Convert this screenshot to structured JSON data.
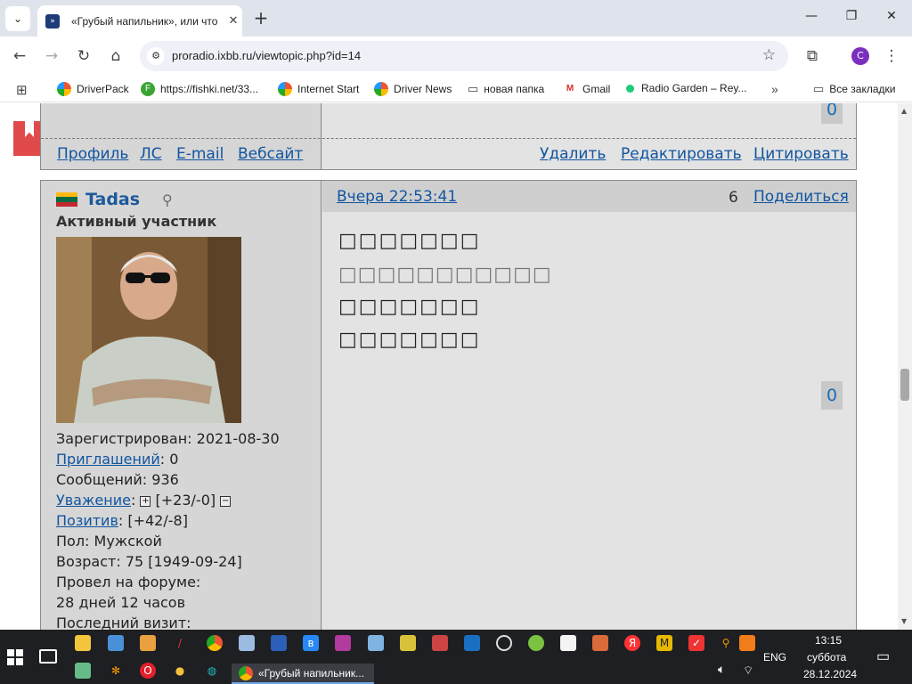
{
  "browser": {
    "tab_title": "«Грубый напильник», или что",
    "url": "proradio.ixbb.ru/viewtopic.php?id=14",
    "profile_initial": "C",
    "bookmarks": [
      "DriverPack",
      "https://fishki.net/33...",
      "Internet Start",
      "Driver News",
      "новая папка",
      "Gmail",
      "Radio Garden – Rey...",
      "Все закладки"
    ]
  },
  "prev_post": {
    "rating": "0",
    "links_left": [
      "Профиль",
      "ЛС",
      "E-mail",
      "Вебсайт"
    ],
    "links_right": [
      "Удалить",
      "Редактировать",
      "Цитировать"
    ]
  },
  "post": {
    "author": "Tadas",
    "rank": "Активный участник",
    "date": "Вчера 22:53:41",
    "number": "6",
    "share": "Поделиться",
    "rating": "0",
    "lines": [
      "□□□□□□□",
      "□□□□□□□□□□□",
      "□□□□□□□",
      "□□□□□□□"
    ],
    "info": {
      "registered_label": "Зарегистрирован:",
      "registered": "2021-08-30",
      "invites_label": "Приглашений",
      "invites": ": 0",
      "messages": "Сообщений: 936",
      "respect_label": "Уважение",
      "respect": "[+23/-0]",
      "positive_label": "Позитив",
      "positive": ": [+42/-8]",
      "gender": "Пол: Мужской",
      "age": "Возраст: 75 [1949-09-24]",
      "forum_time_label": "Провел на форуме:",
      "forum_time": "28 дней 12 часов",
      "last_visit": "Последний визит:"
    }
  },
  "taskbar": {
    "app_label": "«Грубый напильник...",
    "lang": "ENG",
    "time": "13:15",
    "day": "суббота",
    "date": "28.12.2024"
  }
}
